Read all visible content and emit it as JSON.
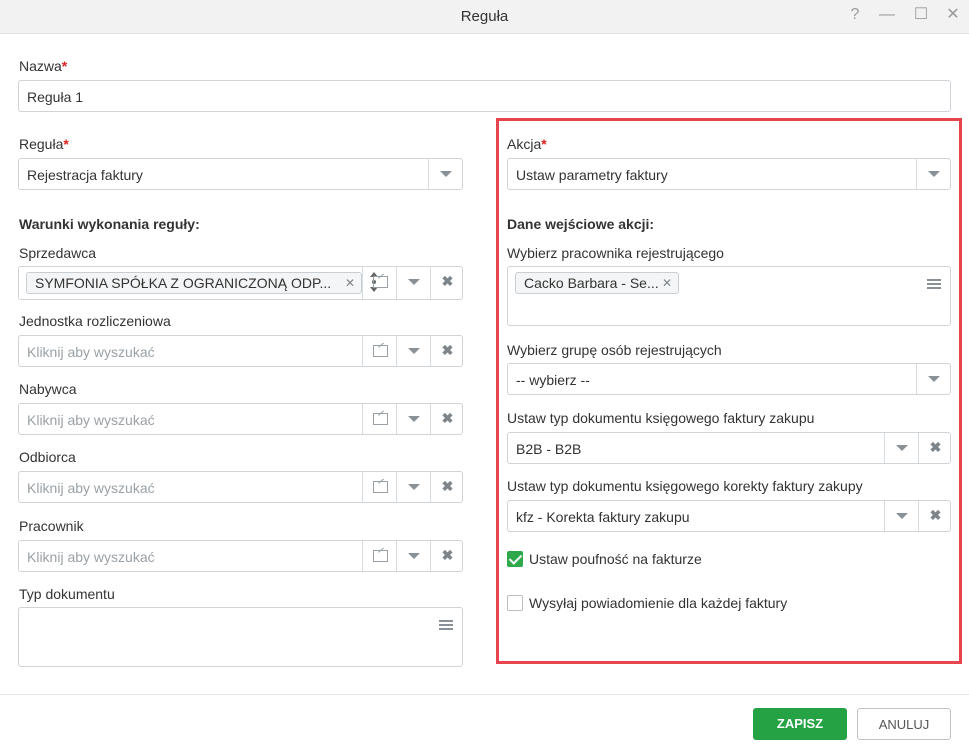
{
  "window": {
    "title": "Reguła",
    "help_label": "?",
    "minimize_label": "—",
    "maximize_label": "☐",
    "close_label": "✕"
  },
  "name_field": {
    "label": "Nazwa",
    "required_mark": "*",
    "value": "Reguła 1"
  },
  "rule_field": {
    "label": "Reguła",
    "required_mark": "*",
    "value": "Rejestracja faktury"
  },
  "conditions": {
    "heading": "Warunki wykonania reguły:",
    "seller": {
      "label": "Sprzedawca",
      "tag": "SYMFONIA SPÓŁKA Z OGRANICZONĄ ODP..."
    },
    "accounting_unit": {
      "label": "Jednostka rozliczeniowa",
      "placeholder": "Kliknij aby wyszukać"
    },
    "buyer": {
      "label": "Nabywca",
      "placeholder": "Kliknij aby wyszukać"
    },
    "recipient": {
      "label": "Odbiorca",
      "placeholder": "Kliknij aby wyszukać"
    },
    "employee": {
      "label": "Pracownik",
      "placeholder": "Kliknij aby wyszukać"
    },
    "doc_type": {
      "label": "Typ dokumentu"
    }
  },
  "action_field": {
    "label": "Akcja",
    "required_mark": "*",
    "value": "Ustaw parametry faktury"
  },
  "action_inputs": {
    "heading": "Dane wejściowe akcji:",
    "registering_employee": {
      "label": "Wybierz pracownika rejestrującego",
      "tag": "Cacko Barbara - Se..."
    },
    "registering_group": {
      "label": "Wybierz grupę osób rejestrujących",
      "value": "-- wybierz --"
    },
    "invoice_doc_type": {
      "label": "Ustaw typ dokumentu księgowego faktury zakupu",
      "value": "B2B - B2B"
    },
    "correction_doc_type": {
      "label": "Ustaw typ dokumentu księgowego korekty faktury zakupy",
      "value": "kfz - Korekta faktury zakupu"
    },
    "confidential": {
      "label": "Ustaw poufność na fakturze",
      "checked": true
    },
    "notify": {
      "label": "Wysyłaj powiadomienie dla każdej faktury",
      "checked": false
    }
  },
  "footer": {
    "save_label": "ZAPISZ",
    "cancel_label": "ANULUJ"
  },
  "colors": {
    "primary_green": "#25a244",
    "highlight_red": "#e8444e",
    "required_red": "#e02020"
  }
}
